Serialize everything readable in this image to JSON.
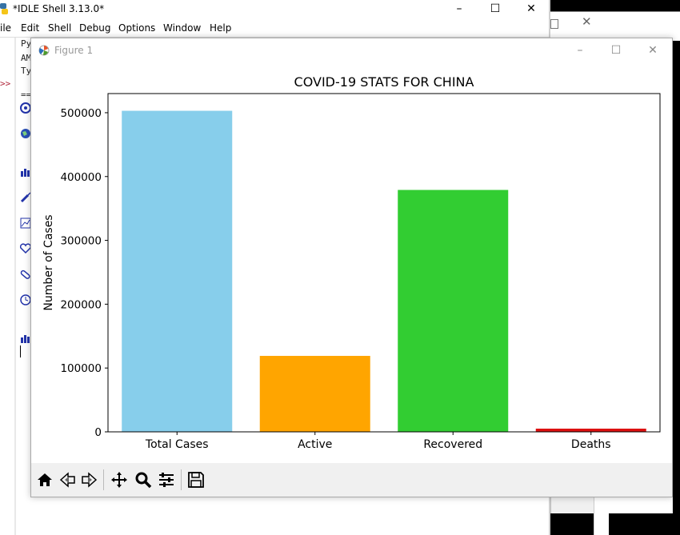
{
  "idle_window": {
    "title": "*IDLE Shell 3.13.0*",
    "menu": [
      "ile",
      "Edit",
      "Shell",
      "Debug",
      "Options",
      "Window",
      "Help"
    ],
    "shell_lines": [
      "Py",
      "AM",
      "Ty"
    ],
    "separator_text": "==",
    "prompt": ">>",
    "minimize_glyph": "–",
    "maximize_glyph": "☐",
    "close_glyph": "✕"
  },
  "behind_window": {
    "close_glyph": "✕"
  },
  "figure_window": {
    "title": "Figure 1",
    "minimize_glyph": "–",
    "maximize_glyph": "☐",
    "close_glyph": "✕",
    "toolbar": [
      {
        "name": "home-icon"
      },
      {
        "name": "back-icon"
      },
      {
        "name": "forward-icon"
      },
      {
        "name": "pan-icon"
      },
      {
        "name": "zoom-icon"
      },
      {
        "name": "configure-subplots-icon"
      },
      {
        "name": "save-icon"
      }
    ]
  },
  "chart_data": {
    "type": "bar",
    "title": "COVID-19 STATS FOR CHINA",
    "xlabel": "",
    "ylabel": "Number of Cases",
    "categories": [
      "Total Cases",
      "Active",
      "Recovered",
      "Deaths"
    ],
    "values": [
      503000,
      119000,
      379000,
      5000
    ],
    "colors": [
      "#87ceeb",
      "#ffa500",
      "#32cd32",
      "#dd1111"
    ],
    "ylim": [
      0,
      530000
    ],
    "yticks": [
      0,
      100000,
      200000,
      300000,
      400000,
      500000
    ],
    "grid": false
  }
}
